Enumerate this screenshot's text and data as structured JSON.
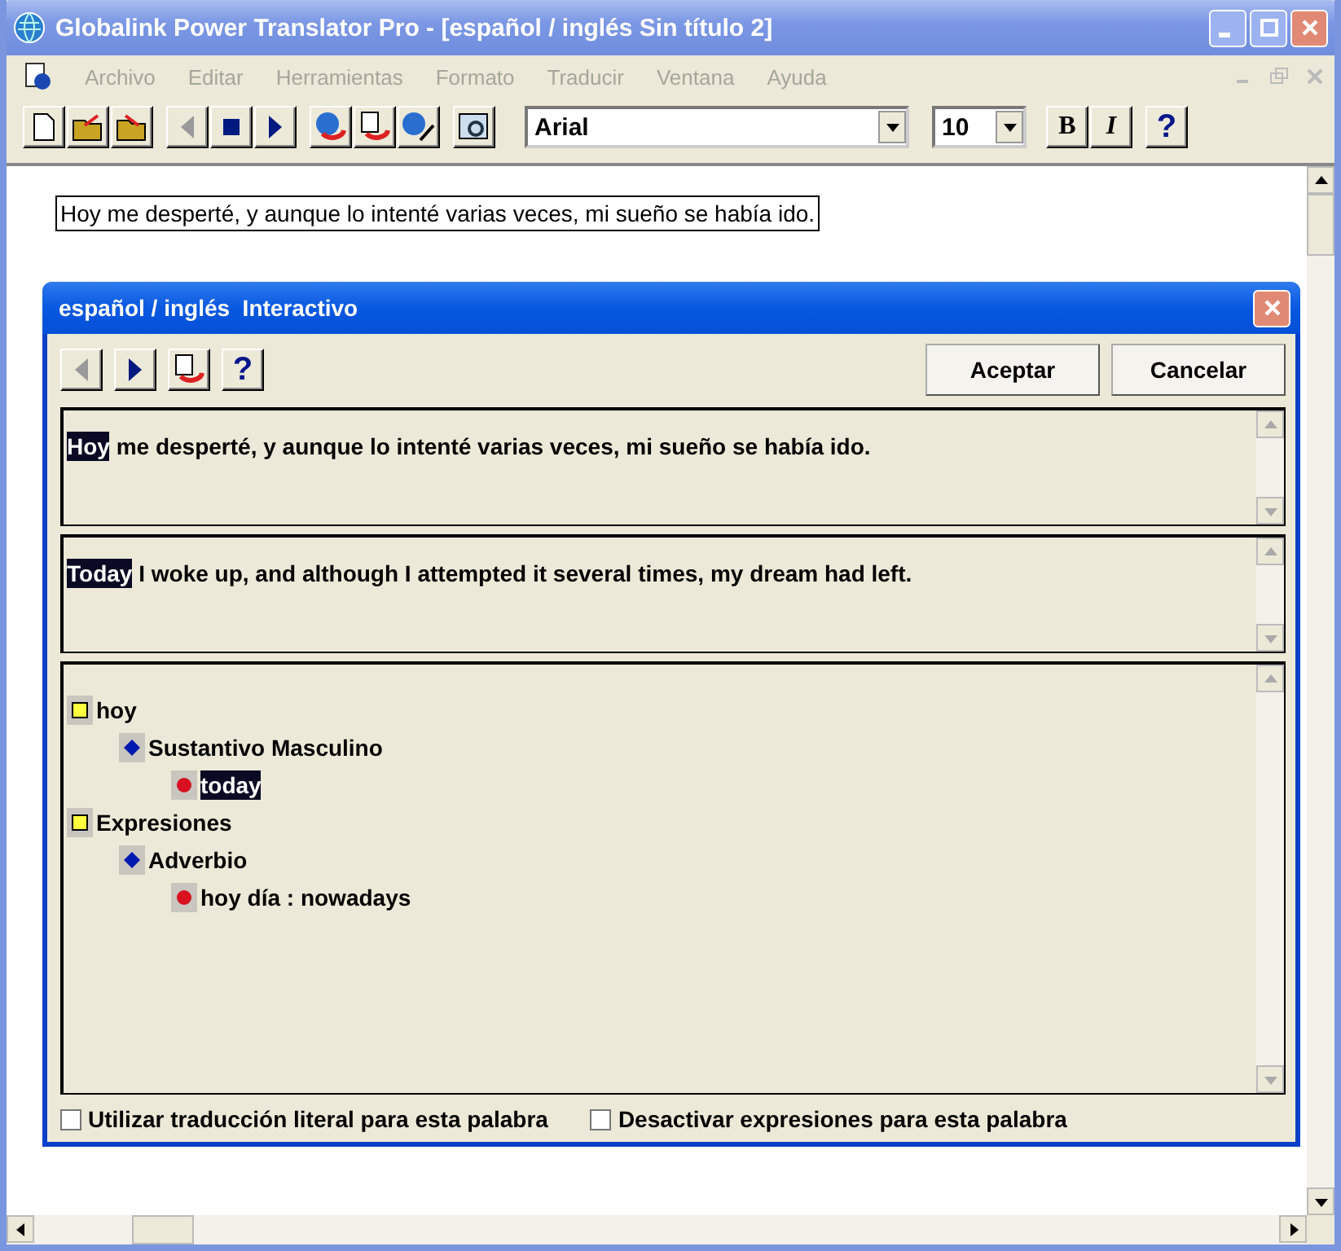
{
  "window": {
    "title": "Globalink Power Translator Pro - [español / inglés Sin título 2]"
  },
  "menu": [
    {
      "label": "Archivo",
      "disabled": true
    },
    {
      "label": "Editar",
      "disabled": true
    },
    {
      "label": "Herramientas",
      "disabled": true
    },
    {
      "label": "Formato",
      "disabled": true
    },
    {
      "label": "Traducir",
      "disabled": true
    },
    {
      "label": "Ventana",
      "disabled": true
    },
    {
      "label": "Ayuda",
      "disabled": true
    }
  ],
  "toolbar": {
    "font": "Arial",
    "size": "10",
    "bold": "B",
    "italic": "I",
    "help": "?"
  },
  "document": {
    "text": "Hoy me desperté, y aunque lo intenté varias veces, mi sueño se había ido."
  },
  "dialog": {
    "title": "español / inglés  Interactivo",
    "help": "?",
    "buttons": [
      "Aceptar",
      "Cancelar"
    ],
    "source": [
      {
        "text": "Hoy",
        "selected": true
      },
      {
        "text": " me desperté, y aunque lo intenté varias veces, mi sueño se había ido.",
        "selected": false
      }
    ],
    "target": [
      {
        "text": "Today",
        "selected": true
      },
      {
        "text": " I woke up, and although I attempted it several times, my dream had left.",
        "selected": false
      }
    ],
    "tree": [
      {
        "label": "hoy",
        "kind": "entry",
        "selected": false,
        "children": [
          {
            "label": "Sustantivo Masculino",
            "kind": "pos",
            "selected": false,
            "children": [
              {
                "label": "today",
                "kind": "meaning",
                "selected": true
              }
            ]
          }
        ]
      },
      {
        "label": "Expresiones",
        "kind": "entry",
        "selected": false,
        "children": [
          {
            "label": "Adverbio",
            "kind": "pos",
            "selected": false,
            "children": [
              {
                "label": "hoy día : nowadays",
                "kind": "meaning",
                "selected": false
              }
            ]
          }
        ]
      }
    ],
    "options": [
      {
        "label": "Utilizar traducción literal para esta palabra",
        "checked": false
      },
      {
        "label": "Desactivar expresiones para esta palabra",
        "checked": false
      }
    ]
  }
}
